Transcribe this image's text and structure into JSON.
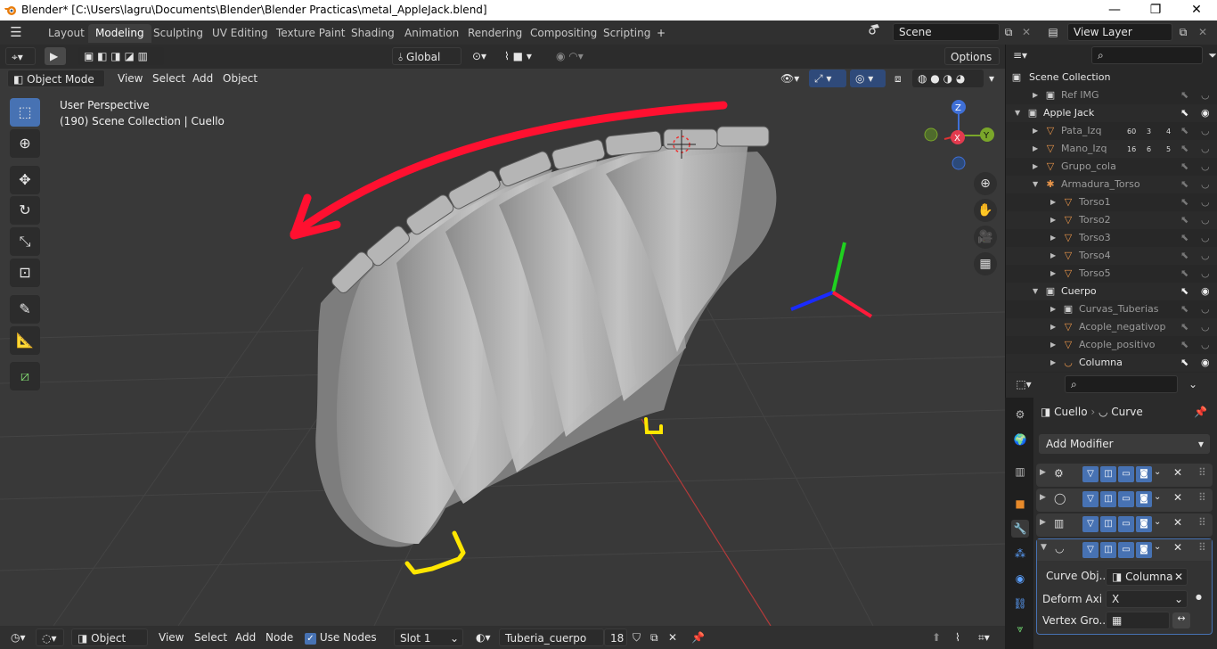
{
  "window": {
    "title": "Blender* [C:\\Users\\lagru\\Documents\\Blender\\Blender Practicas\\metal_AppleJack.blend]",
    "minimize": "—",
    "maximize": "❐",
    "close": "✕"
  },
  "topbar": {
    "menu_icon": "☰",
    "tabs": [
      "Layout",
      "Modeling",
      "Sculpting",
      "UV Editing",
      "Texture Paint",
      "Shading",
      "Animation",
      "Rendering",
      "Compositing",
      "Scripting"
    ],
    "add_tab": "+",
    "scene": "Scene",
    "view_layer": "View Layer"
  },
  "viewport_header": {
    "transform_orientation": "Global",
    "options": "Options",
    "mode": "Object Mode",
    "menus": [
      "View",
      "Select",
      "Add",
      "Object"
    ]
  },
  "viewport": {
    "perspective": "User Perspective",
    "collection_info": "(190) Scene Collection | Cuello",
    "gizmo": {
      "z": "Z",
      "x": "X",
      "y": "Y"
    }
  },
  "outliner": {
    "root": "Scene Collection",
    "rows": [
      {
        "label": "Ref IMG",
        "indent": 1,
        "dim": true,
        "type": "collection"
      },
      {
        "label": "Apple Jack",
        "indent": 0,
        "dim": false,
        "type": "collection"
      },
      {
        "label": "Pata_Izq",
        "indent": 1,
        "dim": true,
        "type": "object",
        "badges": [
          "60",
          "3",
          "4"
        ]
      },
      {
        "label": "Mano_Izq",
        "indent": 1,
        "dim": true,
        "type": "object",
        "badges": [
          "16",
          "6",
          "5"
        ]
      },
      {
        "label": "Grupo_cola",
        "indent": 1,
        "dim": true,
        "type": "object"
      },
      {
        "label": "Armadura_Torso",
        "indent": 1,
        "dim": true,
        "type": "armature"
      },
      {
        "label": "Torso1",
        "indent": 2,
        "dim": true,
        "type": "mesh"
      },
      {
        "label": "Torso2",
        "indent": 2,
        "dim": true,
        "type": "mesh"
      },
      {
        "label": "Torso3",
        "indent": 2,
        "dim": true,
        "type": "mesh"
      },
      {
        "label": "Torso4",
        "indent": 2,
        "dim": true,
        "type": "mesh"
      },
      {
        "label": "Torso5",
        "indent": 2,
        "dim": true,
        "type": "mesh"
      },
      {
        "label": "Cuerpo",
        "indent": 1,
        "dim": false,
        "type": "collection"
      },
      {
        "label": "Curvas_Tuberias",
        "indent": 2,
        "dim": true,
        "type": "collection"
      },
      {
        "label": "Acople_negativop",
        "indent": 2,
        "dim": true,
        "type": "mesh"
      },
      {
        "label": "Acople_positivo",
        "indent": 2,
        "dim": true,
        "type": "mesh"
      },
      {
        "label": "Columna",
        "indent": 2,
        "dim": false,
        "type": "curve"
      }
    ]
  },
  "properties": {
    "object": "Cuello",
    "data": "Curve",
    "add_modifier": "Add Modifier",
    "curve_label": "Curve Obj...",
    "curve_value": "Columna",
    "deform_label": "Deform Axi",
    "deform_value": "X",
    "vgroup_label": "Vertex Gro..."
  },
  "bottombar": {
    "object": "Object",
    "menus": [
      "View",
      "Select",
      "Add",
      "Node"
    ],
    "use_nodes": "Use Nodes",
    "slot": "Slot 1",
    "material": "Tuberia_cuerpo",
    "users": "18"
  },
  "colors": {
    "accent": "#4772b3",
    "arrow_annotation": "#ff1030",
    "yellow_annotation": "#ffe600"
  }
}
